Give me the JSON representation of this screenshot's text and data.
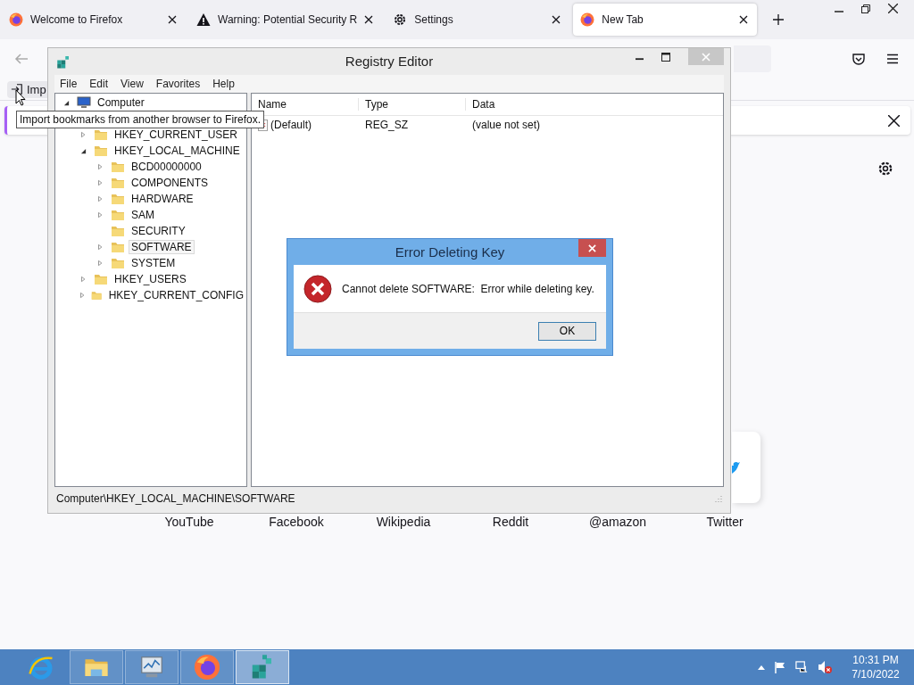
{
  "browser": {
    "tabs": [
      {
        "title": "Welcome to Firefox",
        "selected": false
      },
      {
        "title": "Warning: Potential Security R",
        "selected": false
      },
      {
        "title": "Settings",
        "selected": false
      },
      {
        "title": "New Tab",
        "selected": true
      }
    ],
    "toolbar_button": "Imp",
    "tooltip": "Import bookmarks from another browser to Firefox.",
    "shortcuts": [
      "YouTube",
      "Facebook",
      "Wikipedia",
      "Reddit",
      "@amazon",
      "Twitter"
    ]
  },
  "registry_editor": {
    "title": "Registry Editor",
    "menu": [
      "File",
      "Edit",
      "View",
      "Favorites",
      "Help"
    ],
    "tree": [
      {
        "label": "Computer",
        "expandable": true,
        "expanded": true,
        "selected": false,
        "children": [
          {
            "label": "HKEY_CURRENT_USER",
            "expandable": true,
            "expanded": false,
            "selected": false
          },
          {
            "label": "HKEY_LOCAL_MACHINE",
            "expandable": true,
            "expanded": true,
            "selected": false,
            "children": [
              {
                "label": "BCD00000000",
                "expandable": true,
                "expanded": false,
                "selected": false
              },
              {
                "label": "COMPONENTS",
                "expandable": true,
                "expanded": false,
                "selected": false
              },
              {
                "label": "HARDWARE",
                "expandable": true,
                "expanded": false,
                "selected": false
              },
              {
                "label": "SAM",
                "expandable": true,
                "expanded": false,
                "selected": false
              },
              {
                "label": "SECURITY",
                "expandable": false,
                "expanded": false,
                "selected": false
              },
              {
                "label": "SOFTWARE",
                "expandable": true,
                "expanded": false,
                "selected": true
              },
              {
                "label": "SYSTEM",
                "expandable": true,
                "expanded": false,
                "selected": false
              }
            ]
          },
          {
            "label": "HKEY_USERS",
            "expandable": true,
            "expanded": false,
            "selected": false
          },
          {
            "label": "HKEY_CURRENT_CONFIG",
            "expandable": true,
            "expanded": false,
            "selected": false
          }
        ]
      }
    ],
    "columns": [
      "Name",
      "Type",
      "Data"
    ],
    "rows": [
      [
        "(Default)",
        "REG_SZ",
        "(value not set)"
      ]
    ],
    "status_bar": "Computer\\HKEY_LOCAL_MACHINE\\SOFTWARE"
  },
  "error_dialog": {
    "title": "Error Deleting Key",
    "message": "Cannot delete SOFTWARE:  Error while deleting key.",
    "buttons": [
      "OK"
    ]
  },
  "taskbar": {
    "apps": [
      {
        "selected": false
      },
      {
        "selected": false
      },
      {
        "selected": false
      },
      {
        "selected": false
      },
      {
        "selected": true
      }
    ],
    "time": "10:31 PM",
    "date": "7/10/2022"
  }
}
